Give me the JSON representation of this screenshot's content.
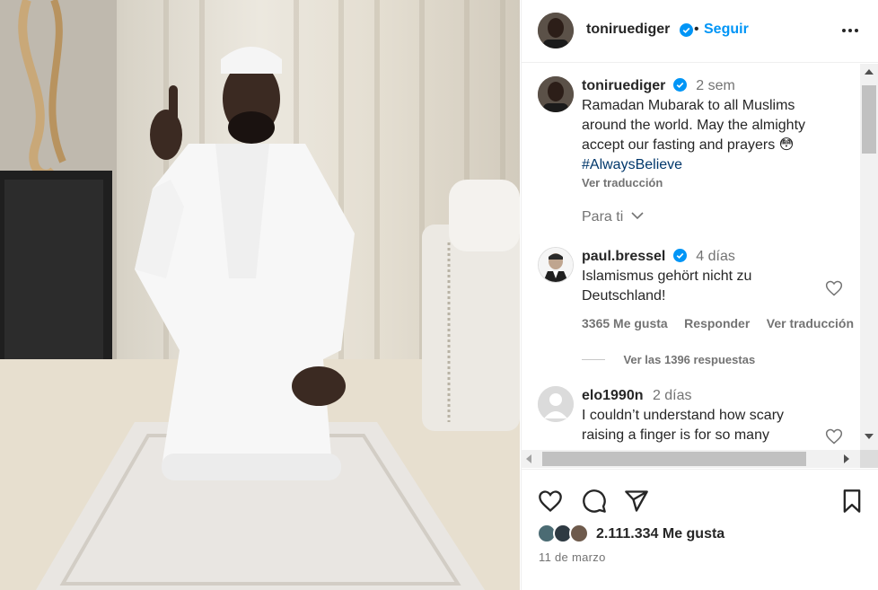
{
  "post": {
    "username": "toniruediger",
    "follow_label": "Seguir",
    "separator": "•",
    "more_icon": "more-horizontal-icon"
  },
  "caption": {
    "username": "toniruediger",
    "time": "2 sem",
    "text_line1": "Ramadan Mubarak to all Muslims",
    "text_line2": "around the world. May the almighty",
    "text_line3": "accept our fasting and prayers 😳",
    "hashtag": "#AlwaysBelieve",
    "translate_label": "Ver traducción",
    "for_you_label": "Para ti"
  },
  "comments": [
    {
      "username": "paul.bressel",
      "verified": true,
      "time": "4 días",
      "text_line1": "Islamismus gehört nicht zu",
      "text_line2": "Deutschland!",
      "likes_label": "3365 Me gusta",
      "reply_label": "Responder",
      "translate_label": "Ver traducción",
      "replies_label": "Ver las 1396 respuestas"
    },
    {
      "username": "elo1990n",
      "verified": false,
      "time": "2 días",
      "text_line1": "I couldn’t understand how scary",
      "text_line2": "raising a finger is for so many"
    }
  ],
  "footer": {
    "likes": "2.111.334 Me gusta",
    "date": "11 de marzo"
  },
  "colors": {
    "accent": "#0095f6",
    "text": "#262626",
    "muted": "#737373",
    "hashtag": "#00376b"
  }
}
